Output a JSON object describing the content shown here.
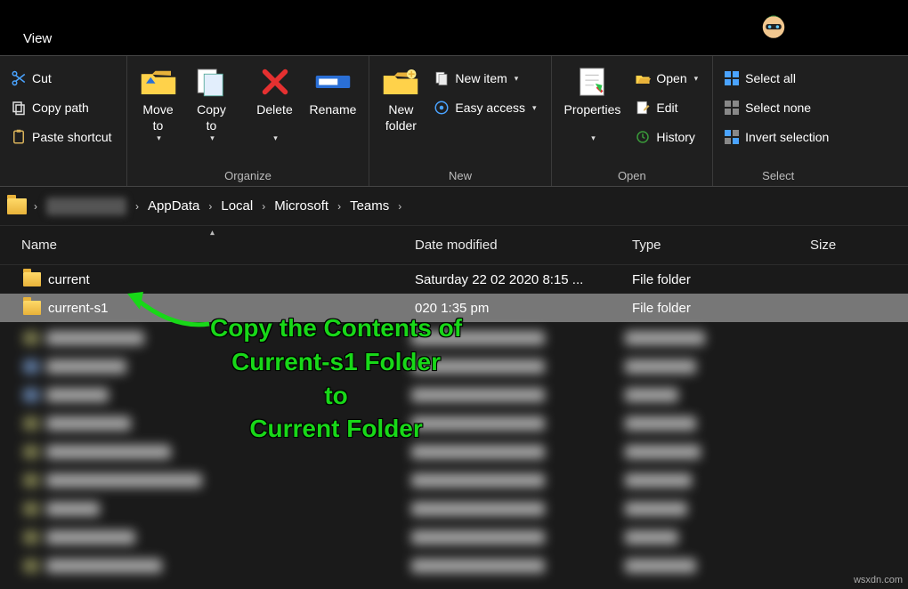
{
  "titlebar": {
    "view": "View"
  },
  "ribbon": {
    "clipboard": {
      "cut": "Cut",
      "copy_path": "Copy path",
      "paste_shortcut": "Paste shortcut"
    },
    "organize": {
      "label": "Organize",
      "move_to": "Move\nto",
      "copy_to": "Copy\nto",
      "delete": "Delete",
      "rename": "Rename"
    },
    "new": {
      "label": "New",
      "new_folder": "New\nfolder",
      "new_item": "New item",
      "easy_access": "Easy access"
    },
    "open": {
      "label": "Open",
      "properties": "Properties",
      "open": "Open",
      "edit": "Edit",
      "history": "History"
    },
    "select": {
      "label": "Select",
      "select_all": "Select all",
      "select_none": "Select none",
      "invert": "Invert selection"
    }
  },
  "breadcrumb": [
    "AppData",
    "Local",
    "Microsoft",
    "Teams"
  ],
  "columns": {
    "name": "Name",
    "date": "Date modified",
    "type": "Type",
    "size": "Size"
  },
  "rows": [
    {
      "name": "current",
      "date": "Saturday 22 02 2020 8:15 ...",
      "type": "File folder",
      "selected": false
    },
    {
      "name": "current-s1",
      "date": "020 1:35 pm",
      "type": "File folder",
      "selected": true
    }
  ],
  "annotation": {
    "l1": "Copy the Contents of",
    "l2": "Current-s1 Folder",
    "l3": "to",
    "l4": "Current Folder"
  },
  "watermark": "wsxdn.com"
}
